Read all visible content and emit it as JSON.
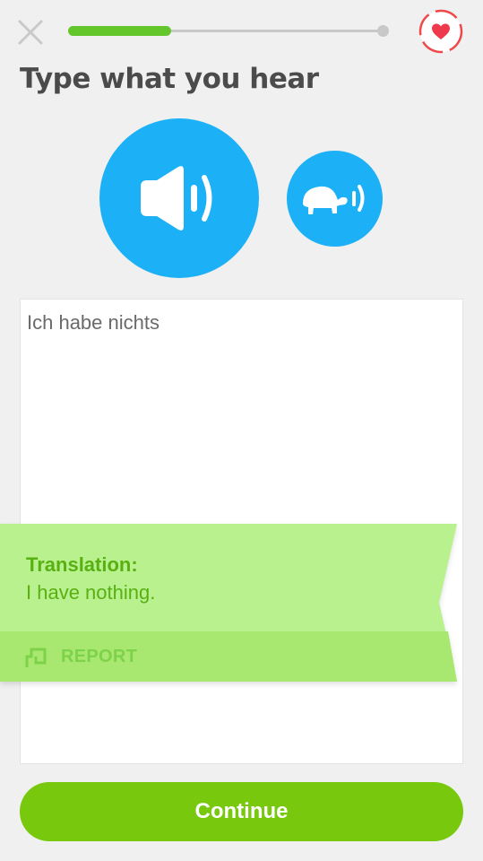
{
  "header": {
    "close_icon": "close-icon",
    "progress_fraction": 0.32,
    "progress_fill_color": "#63c62b",
    "heart_icon": "heart-icon"
  },
  "prompt": {
    "title": "Type what you hear"
  },
  "audio": {
    "play_icon": "speaker-icon",
    "slow_icon": "turtle-icon",
    "button_color": "#1cb0f6"
  },
  "answer": {
    "value": "Ich habe nichts"
  },
  "feedback": {
    "label": "Translation:",
    "text": "I have nothing.",
    "report_icon": "flag-icon",
    "report_label": "REPORT",
    "banner_color": "#b9f18e"
  },
  "footer": {
    "continue_label": "Continue",
    "continue_color": "#78c80e"
  }
}
